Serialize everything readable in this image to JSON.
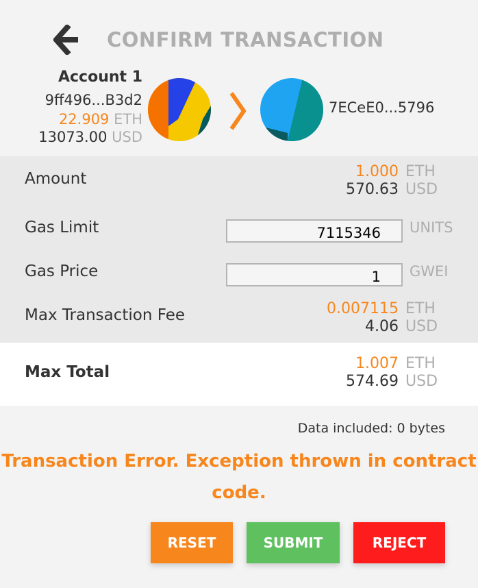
{
  "header": {
    "title": "CONFIRM TRANSACTION"
  },
  "from": {
    "name": "Account 1",
    "address": "9ff496...B3d2",
    "balance_eth": "22.909",
    "balance_eth_unit": "ETH",
    "balance_usd": "13073.00",
    "balance_usd_unit": "USD"
  },
  "to": {
    "address": "7ECeE0...5796"
  },
  "details": {
    "amount": {
      "label": "Amount",
      "eth": "1.000",
      "eth_unit": "ETH",
      "usd": "570.63",
      "usd_unit": "USD"
    },
    "gas_limit": {
      "label": "Gas Limit",
      "value": "7115346",
      "unit": "UNITS"
    },
    "gas_price": {
      "label": "Gas Price",
      "value": "1",
      "unit": "GWEI"
    },
    "max_fee": {
      "label": "Max Transaction Fee",
      "eth": "0.007115",
      "eth_unit": "ETH",
      "usd": "4.06",
      "usd_unit": "USD"
    }
  },
  "total": {
    "label": "Max Total",
    "eth": "1.007",
    "eth_unit": "ETH",
    "usd": "574.69",
    "usd_unit": "USD"
  },
  "data_included": "Data included: 0 bytes",
  "error": {
    "line1": "Transaction Error. Exception thrown in contract",
    "line2": "code."
  },
  "buttons": {
    "reset": "RESET",
    "submit": "SUBMIT",
    "reject": "REJECT"
  },
  "colors": {
    "accent": "#f7861c",
    "submit": "#5ec05f",
    "reject": "#ff1c1c",
    "muted": "#aeaeae"
  },
  "icons": {
    "back": "arrow-left-icon",
    "chevron": "chevron-right-icon"
  }
}
